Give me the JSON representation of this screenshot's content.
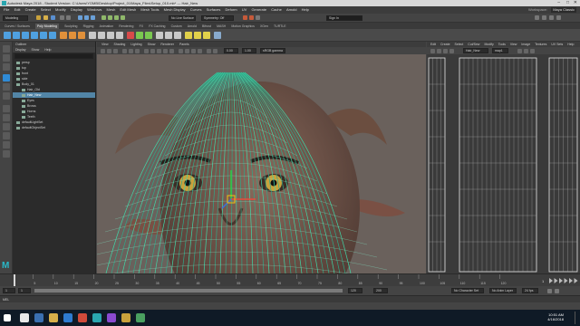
{
  "window": {
    "title": "Autodesk Maya 2018 - Student Version: C:\\Users\\YOMB\\Desktop\\Project_01\\Maya_Files\\Setup_010.mb* --- Hair_New",
    "minimize": "–",
    "maximize": "□",
    "close": "✕"
  },
  "menubar": {
    "items": [
      "File",
      "Edit",
      "Create",
      "Select",
      "Modify",
      "Display",
      "Windows",
      "Mesh",
      "Edit Mesh",
      "Mesh Tools",
      "Mesh Display",
      "Curves",
      "Surfaces",
      "Deform",
      "UV",
      "Generate",
      "Cache",
      "Arnold",
      "Help"
    ],
    "workspace_label": "Workspace:",
    "workspace_value": "Maya Classic"
  },
  "statusline": {
    "mode": "Modeling",
    "no_live_surface": "No Live Surface",
    "symmetry": "Symmetry: Off",
    "sign_in": "Sign In"
  },
  "shelf": {
    "tabs": [
      "Curves / Surfaces",
      "Poly Modeling",
      "Sculpting",
      "Rigging",
      "Animation",
      "Rendering",
      "FX",
      "FX Caching",
      "Custom",
      "Arnold",
      "Bifrost",
      "MASH",
      "Motion Graphics",
      "XGen",
      "TURTLE"
    ],
    "active_tab": "Poly Modeling"
  },
  "outliner": {
    "title": "Outliner",
    "menu": [
      "Display",
      "Show",
      "Help"
    ],
    "rows": [
      {
        "label": "persp",
        "indent": 0,
        "selected": false
      },
      {
        "label": "top",
        "indent": 0,
        "selected": false
      },
      {
        "label": "front",
        "indent": 0,
        "selected": false
      },
      {
        "label": "side",
        "indent": 0,
        "selected": false
      },
      {
        "label": "Body_01",
        "indent": 0,
        "selected": false
      },
      {
        "label": "Hair_Old",
        "indent": 1,
        "selected": false
      },
      {
        "label": "Hair_New",
        "indent": 1,
        "selected": true
      },
      {
        "label": "Eyes",
        "indent": 1,
        "selected": false
      },
      {
        "label": "Brows",
        "indent": 1,
        "selected": false
      },
      {
        "label": "Horns",
        "indent": 1,
        "selected": false
      },
      {
        "label": "Teeth",
        "indent": 1,
        "selected": false
      },
      {
        "label": "defaultLightSet",
        "indent": 0,
        "selected": false
      },
      {
        "label": "defaultObjectSet",
        "indent": 0,
        "selected": false
      }
    ]
  },
  "viewport": {
    "menu": [
      "View",
      "Shading",
      "Lighting",
      "Show",
      "Renderer",
      "Panels"
    ],
    "values": [
      "0.00",
      "1.00"
    ],
    "color_space": "sRGB gamma"
  },
  "uv_editor": {
    "menu": [
      "Edit",
      "Create",
      "Select",
      "Cut/Sew",
      "Modify",
      "Tools",
      "View",
      "Image",
      "Textures",
      "UV Sets",
      "Help"
    ],
    "uv_set": "Hair_New",
    "uv_set_map": "map1"
  },
  "timeslider": {
    "ticks": [
      "5",
      "10",
      "15",
      "20",
      "25",
      "30",
      "35",
      "40",
      "45",
      "50",
      "55",
      "60",
      "65",
      "70",
      "75",
      "80",
      "85",
      "90",
      "95",
      "100",
      "105",
      "110",
      "115",
      "120"
    ],
    "current_frame": "1"
  },
  "rangeslider": {
    "start": "1",
    "min": "1",
    "end": "120",
    "end_max": "200",
    "character_set": "No Character Set",
    "anim_layer": "No Anim Layer",
    "fps": "24 fps"
  },
  "cmdline": {
    "label": "MEL"
  },
  "taskbar": {
    "time": "10:51 AM",
    "date": "4/16/2018"
  }
}
